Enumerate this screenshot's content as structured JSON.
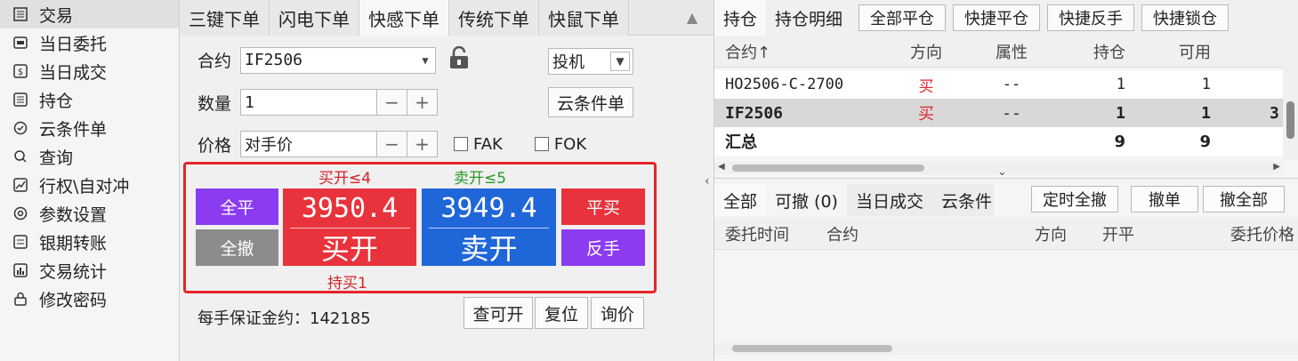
{
  "sidebar": {
    "items": [
      {
        "label": "交易",
        "icon": "list-icon"
      },
      {
        "label": "当日委托",
        "icon": "order-icon"
      },
      {
        "label": "当日成交",
        "icon": "deal-icon"
      },
      {
        "label": "持仓",
        "icon": "position-icon"
      },
      {
        "label": "云条件单",
        "icon": "check-circle-icon"
      },
      {
        "label": "查询",
        "icon": "search-icon"
      },
      {
        "label": "行权\\自对冲",
        "icon": "trend-icon"
      },
      {
        "label": "参数设置",
        "icon": "gear-icon"
      },
      {
        "label": "银期转账",
        "icon": "transfer-icon"
      },
      {
        "label": "交易统计",
        "icon": "stats-icon"
      },
      {
        "label": "修改密码",
        "icon": "lock-icon"
      }
    ]
  },
  "order": {
    "tabs": [
      "三键下单",
      "闪电下单",
      "快感下单",
      "传统下单",
      "快鼠下单"
    ],
    "contract_label": "合约",
    "contract_value": "IF2506",
    "hedge_value": "投机",
    "qty_label": "数量",
    "qty_value": "1",
    "cloud_btn": "云条件单",
    "price_label": "价格",
    "price_value": "对手价",
    "fak": "FAK",
    "fok": "FOK",
    "buy_hint": "买开≤4",
    "sell_hint": "卖开≤5",
    "hold_hint": "持买1",
    "close_all": "全平",
    "cancel_all": "全撤",
    "buy_price": "3950.4",
    "buy_action": "买开",
    "sell_price": "3949.4",
    "sell_action": "卖开",
    "close_buy": "平买",
    "reverse": "反手",
    "margin_label": "每手保证金约：142185",
    "btn_check": "查可开",
    "btn_reset": "复位",
    "btn_quote": "询价"
  },
  "position": {
    "tabs": [
      "持仓",
      "持仓明细"
    ],
    "buttons": [
      "全部平仓",
      "快捷平仓",
      "快捷反手",
      "快捷锁仓"
    ],
    "headers": [
      "合约↑",
      "方向",
      "属性",
      "持仓",
      "可用"
    ],
    "rows": [
      {
        "contract": "HO2506-C-2700",
        "dir": "买",
        "attr": "--",
        "hold": "1",
        "avail": "1",
        "extra": ""
      },
      {
        "contract": "IF2506",
        "dir": "买",
        "attr": "--",
        "hold": "1",
        "avail": "1",
        "extra": "3"
      }
    ],
    "summary": {
      "label": "汇总",
      "hold": "9",
      "avail": "9"
    }
  },
  "orders": {
    "tabs": [
      "全部",
      "可撤 (0)",
      "当日成交",
      "云条件"
    ],
    "buttons": [
      "定时全撤",
      "撤单",
      "撤全部"
    ],
    "headers": [
      "委托时间",
      "合约",
      "方向",
      "开平",
      "委托价格"
    ]
  },
  "colors": {
    "buy_red": "#e8333c",
    "sell_blue": "#1f66d9",
    "purple": "#8b3cf0",
    "gray": "#8c8c8c",
    "box_red": "#e3262a",
    "hint_red": "#d4242a",
    "hint_green": "#2a9a2a"
  }
}
